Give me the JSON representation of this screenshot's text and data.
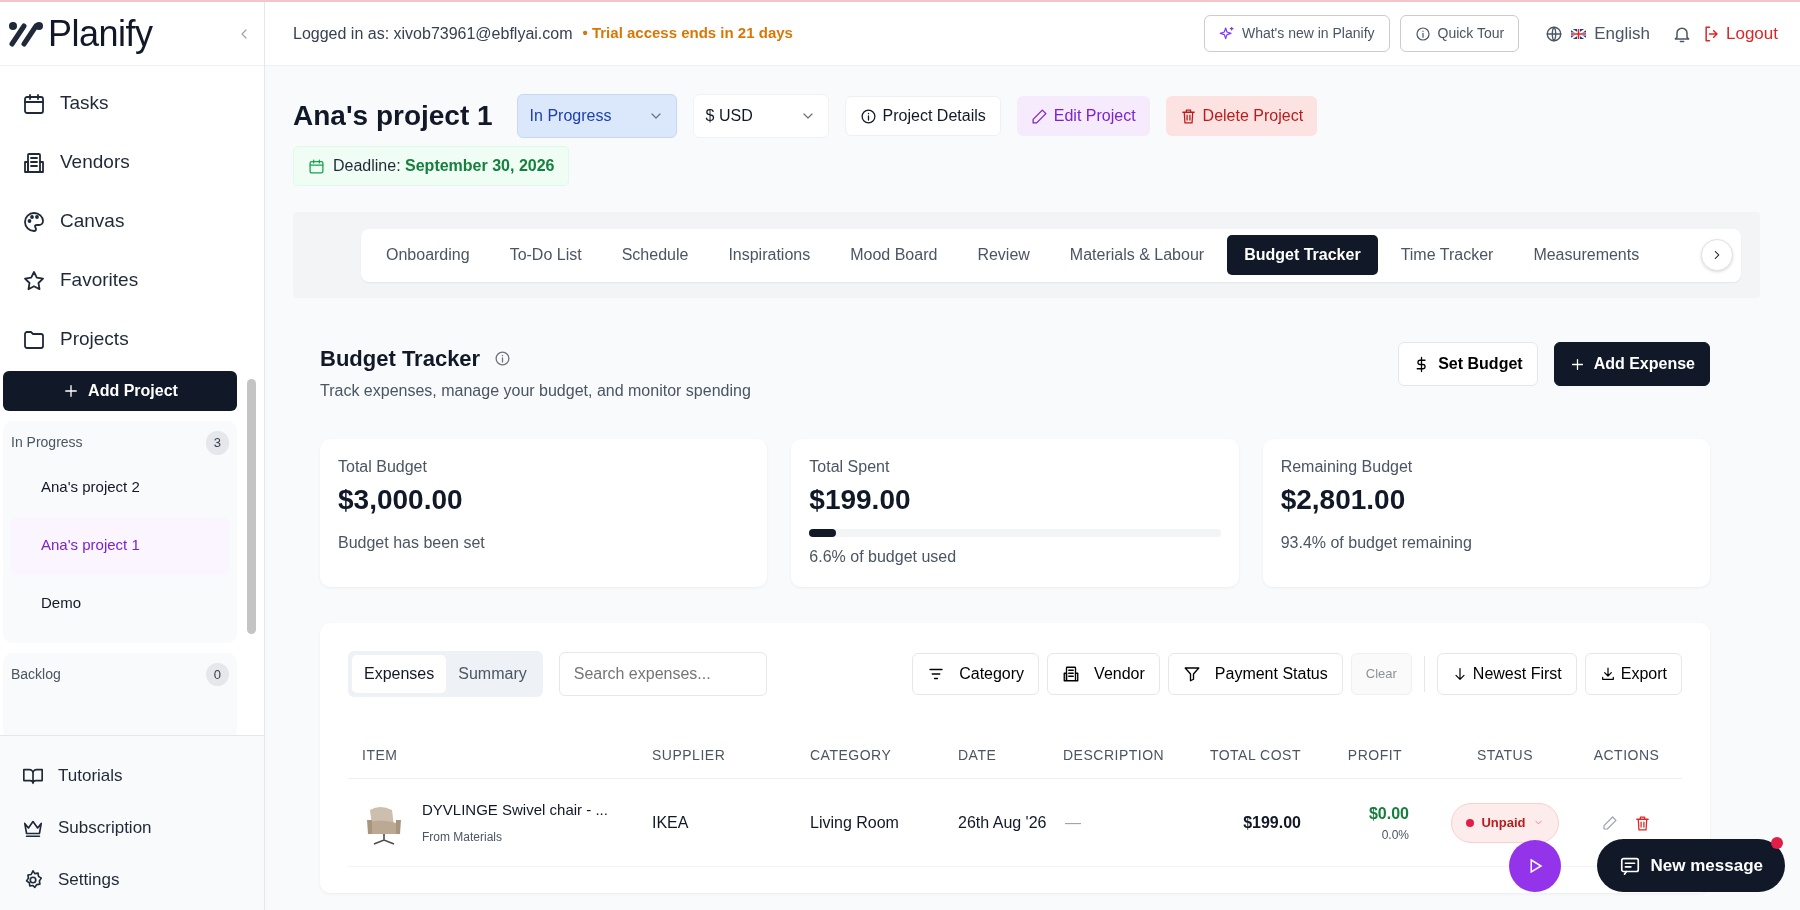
{
  "sidebar": {
    "logo": "Planify",
    "nav": [
      {
        "label": "Tasks"
      },
      {
        "label": "Vendors"
      },
      {
        "label": "Canvas"
      },
      {
        "label": "Favorites"
      },
      {
        "label": "Projects"
      }
    ],
    "add_project": "Add Project",
    "groups": [
      {
        "title": "In Progress",
        "count": "3",
        "projects": [
          {
            "name": "Ana's project 2",
            "selected": false
          },
          {
            "name": "Ana's project 1",
            "selected": true
          },
          {
            "name": "Demo",
            "selected": false
          }
        ]
      },
      {
        "title": "Backlog",
        "count": "0"
      }
    ],
    "bottom_nav": [
      {
        "label": "Tutorials"
      },
      {
        "label": "Subscription"
      },
      {
        "label": "Settings"
      }
    ]
  },
  "topbar": {
    "logged_in": "Logged in as: xivob73961@ebflyai.com",
    "trial": "• Trial access ends in 21 days",
    "whats_new": "What's new in Planify",
    "quick_tour": "Quick Tour",
    "language": "English",
    "logout": "Logout"
  },
  "project": {
    "title": "Ana's project 1",
    "status": "In Progress",
    "currency": "$ USD",
    "actions": [
      {
        "kind": "details",
        "label": "Project Details"
      },
      {
        "kind": "edit",
        "label": "Edit Project"
      },
      {
        "kind": "delete",
        "label": "Delete Project"
      }
    ],
    "deadline_label": "Deadline:",
    "deadline": "September 30, 2026"
  },
  "tabs": [
    {
      "label": "Onboarding",
      "selected": false
    },
    {
      "label": "To-Do List",
      "selected": false
    },
    {
      "label": "Schedule",
      "selected": false
    },
    {
      "label": "Inspirations",
      "selected": false
    },
    {
      "label": "Mood Board",
      "selected": false
    },
    {
      "label": "Review",
      "selected": false
    },
    {
      "label": "Materials & Labour",
      "selected": false
    },
    {
      "label": "Budget Tracker",
      "selected": true
    },
    {
      "label": "Time Tracker",
      "selected": false
    },
    {
      "label": "Measurements",
      "selected": false
    }
  ],
  "budget": {
    "title": "Budget Tracker",
    "subtitle": "Track expenses, manage your budget, and monitor spending",
    "set_budget": "Set Budget",
    "add_expense": "Add Expense",
    "cards": [
      {
        "label": "Total Budget",
        "value": "$3,000.00",
        "note": "Budget has been set"
      },
      {
        "label": "Total Spent",
        "value": "$199.00",
        "level": 0.066,
        "note": "6.6% of budget used"
      },
      {
        "label": "Remaining Budget",
        "value": "$2,801.00",
        "note": "93.4% of budget remaining"
      }
    ]
  },
  "expenses": {
    "views": [
      {
        "label": "Expenses",
        "selected": true
      },
      {
        "label": "Summary",
        "selected": false
      }
    ],
    "search": {
      "placeholder": "Search expenses..."
    },
    "filters": [
      {
        "label": "Category"
      },
      {
        "label": "Vendor"
      },
      {
        "label": "Payment Status"
      }
    ],
    "clear": {
      "label": "Clear",
      "disabled": true
    },
    "sort": "Newest First",
    "export": "Export",
    "columns": [
      "ITEM",
      "SUPPLIER",
      "CATEGORY",
      "DATE",
      "DESCRIPTION",
      "TOTAL COST",
      "PROFIT",
      "STATUS",
      "ACTIONS"
    ],
    "rows": [
      {
        "item": "DYVLINGE Swivel chair - ...",
        "source": "From Materials",
        "supplier": "IKEA",
        "category": "Living Room",
        "date": "26th Aug '26",
        "description": "—",
        "total_cost": "$199.00",
        "profit": "$0.00",
        "profit_pct": "0.0%",
        "status": "Unpaid"
      }
    ]
  },
  "chat": {
    "label": "New message",
    "unread": true
  }
}
